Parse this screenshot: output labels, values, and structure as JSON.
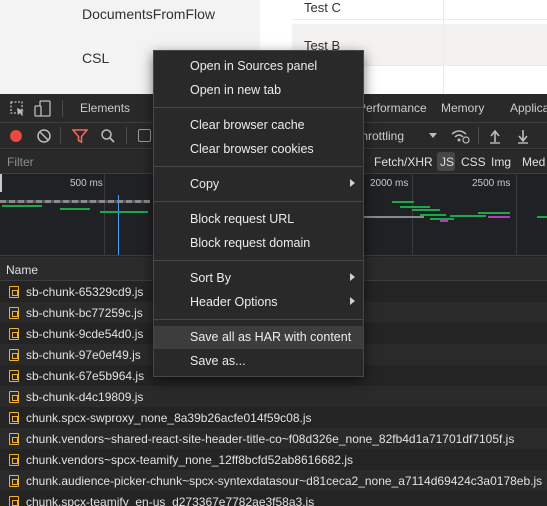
{
  "webpage": {
    "nav_items": [
      "DocumentsFromFlow",
      "CSL"
    ],
    "list_rows": [
      "Test C",
      "Test B"
    ]
  },
  "devtools": {
    "tabs": [
      "Elements",
      "Performance",
      "Memory",
      "Applica"
    ],
    "throttling_label": "throttling",
    "filter_placeholder": "Filter",
    "filter_types": [
      "Fetch/XHR",
      "JS",
      "CSS",
      "Img",
      "Med"
    ],
    "active_filter_type": "JS",
    "timeline_ticks": [
      "500 ms",
      "2000 ms",
      "2500 ms"
    ],
    "column_header": "Name",
    "files": [
      "sb-chunk-65329cd9.js",
      "sb-chunk-bc77259c.js",
      "sb-chunk-9cde54d0.js",
      "sb-chunk-97e0ef49.js",
      "sb-chunk-67e5b964.js",
      "sb-chunk-d4c19809.js",
      "chunk.spcx-swproxy_none_8a39b26acfe014f59c08.js",
      "chunk.vendors~shared-react-site-header-title-co~f08d326e_none_82fb4d1a71701df7105f.js",
      "chunk.vendors~spcx-teamify_none_12ff8bcfd52ab8616682.js",
      "chunk.audience-picker-chunk~spcx-syntexdatasour~d81ceca2_none_a7114d69424c3a0178eb.js",
      "chunk.spcx-teamify_en-us_d273367e7782ae3f58a3.js"
    ]
  },
  "context_menu": {
    "groups": [
      [
        "Open in Sources panel",
        "Open in new tab"
      ],
      [
        "Clear browser cache",
        "Clear browser cookies"
      ],
      [
        "Copy"
      ],
      [
        "Block request URL",
        "Block request domain"
      ],
      [
        "Sort By",
        "Header Options"
      ],
      [
        "Save all as HAR with content",
        "Save as..."
      ]
    ],
    "highlighted": "Save all as HAR with content",
    "submenu_items": [
      "Copy",
      "Sort By",
      "Header Options"
    ]
  },
  "colors": {
    "record_red": "#e8483f",
    "filter_orange": "#f46c5e",
    "file_icon_amber": "#f2b035",
    "waterfall_green": "#1fa64a",
    "waterfall_magenta": "#b13cc0",
    "timeline_blue_marker": "#4a9eff"
  }
}
